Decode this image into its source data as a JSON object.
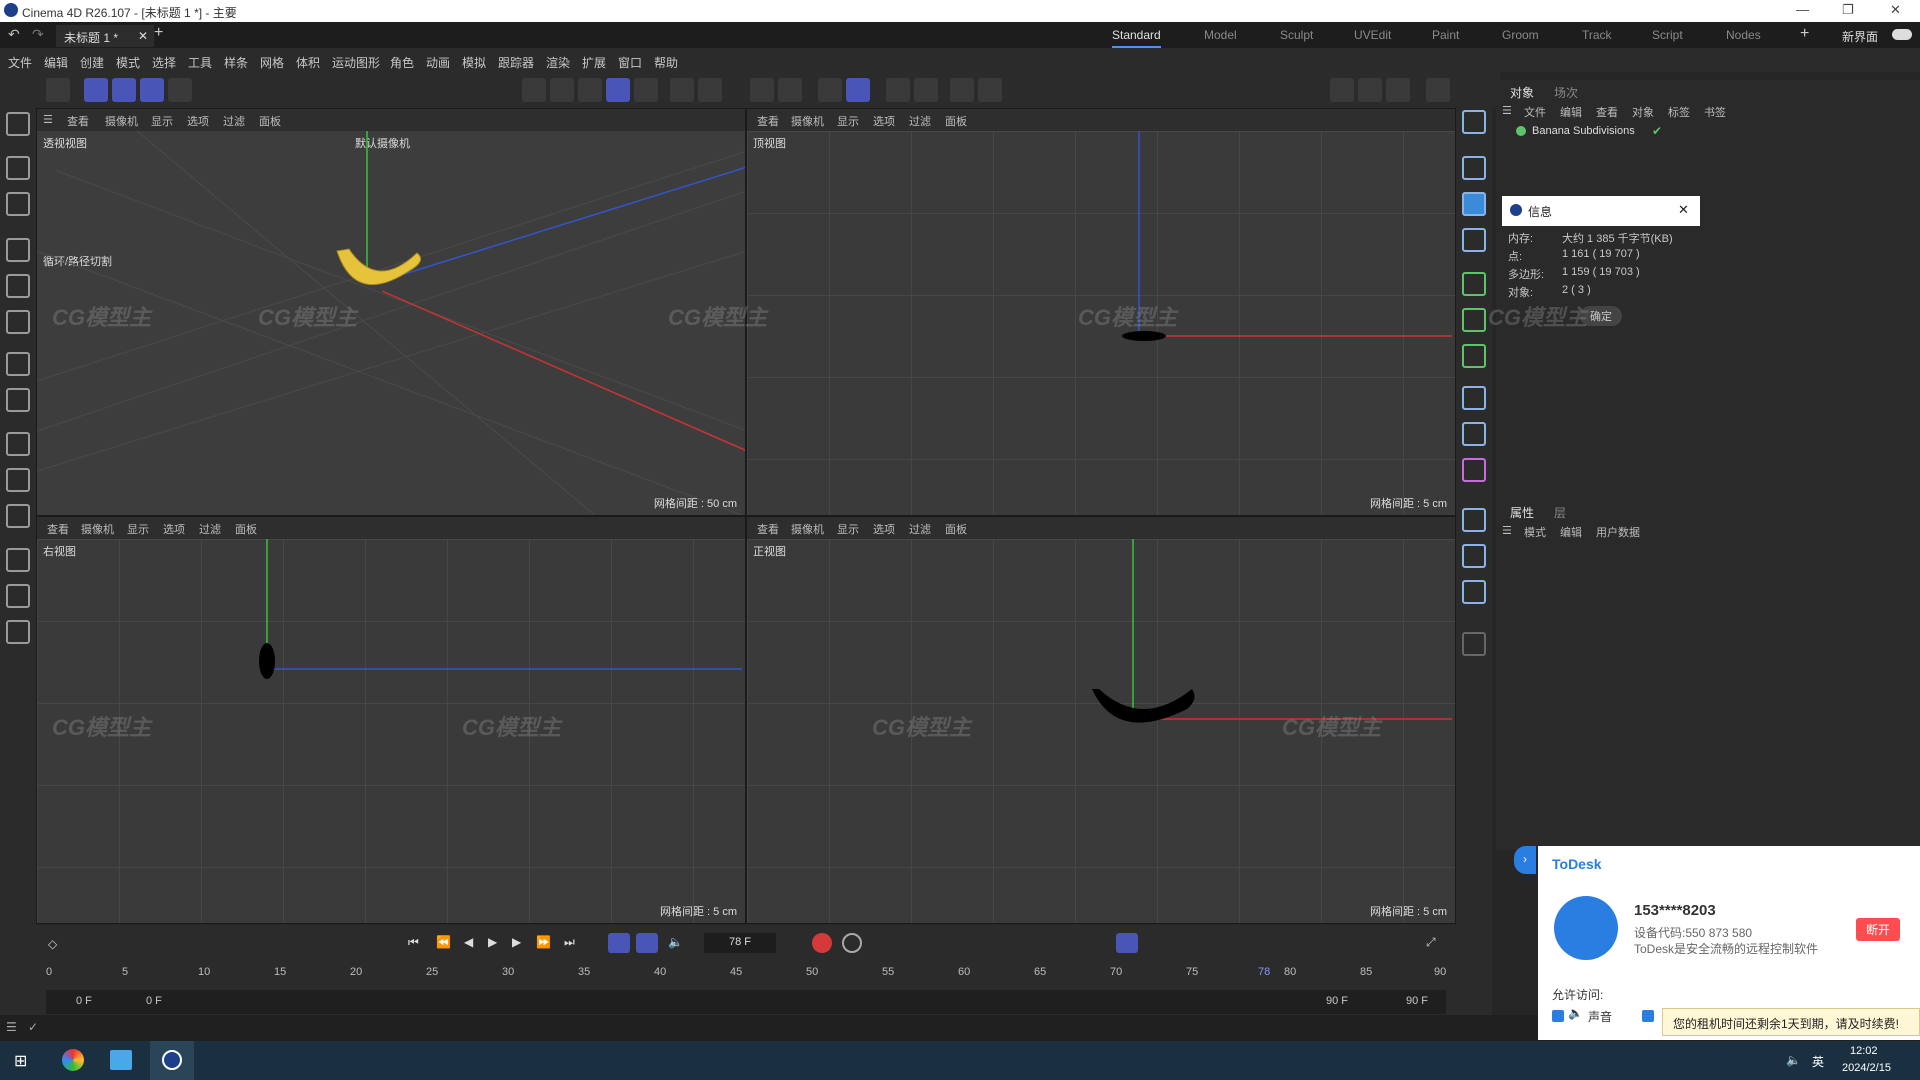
{
  "title": "Cinema 4D R26.107 - [未标题 1 *] - 主要",
  "doc_tab": "未标题 1 *",
  "layouts": [
    "Standard",
    "Model",
    "Sculpt",
    "UVEdit",
    "Paint",
    "Groom",
    "Track",
    "Script",
    "Nodes"
  ],
  "new_interface": "新界面",
  "menus": [
    "文件",
    "编辑",
    "创建",
    "模式",
    "选择",
    "工具",
    "样条",
    "网格",
    "体积",
    "运动图形",
    "角色",
    "动画",
    "模拟",
    "跟踪器",
    "渲染",
    "扩展",
    "窗口",
    "帮助"
  ],
  "viewport_menu": [
    "查看",
    "摄像机",
    "显示",
    "选项",
    "过滤",
    "面板"
  ],
  "viewports": [
    {
      "label": "透视视图",
      "camera": "默认摄像机",
      "loop_cut": "循环/路径切割",
      "grid": "网格间距 : 50 cm"
    },
    {
      "label": "顶视图",
      "grid": "网格间距 : 5 cm"
    },
    {
      "label": "右视图",
      "grid": "网格间距 : 5 cm"
    },
    {
      "label": "正视图",
      "grid": "网格间距 : 5 cm"
    }
  ],
  "object_panel": {
    "tabs": [
      "对象",
      "场次"
    ],
    "menu": [
      "文件",
      "编辑",
      "查看",
      "对象",
      "标签",
      "书签"
    ],
    "item": "Banana Subdivisions"
  },
  "info": {
    "title": "信息",
    "rows": [
      [
        "内存:",
        "大约 1 385 千字节(KB)"
      ],
      [
        "点:",
        "1 161 ( 19 707 )"
      ],
      [
        "多边形:",
        "1 159 ( 19 703 )"
      ],
      [
        "对象:",
        "2 ( 3 )"
      ]
    ],
    "ok": "确定"
  },
  "attr_panel": {
    "tabs": [
      "属性",
      "层"
    ],
    "menu": [
      "模式",
      "编辑",
      "用户数据"
    ]
  },
  "timeline": {
    "frame": "78 F",
    "ruler": [
      "0",
      "5",
      "10",
      "15",
      "20",
      "25",
      "30",
      "35",
      "40",
      "45",
      "50",
      "55",
      "60",
      "65",
      "70",
      "75",
      "78",
      "80",
      "85",
      "90"
    ],
    "start": "0 F",
    "start2": "0 F",
    "end": "90 F",
    "end2": "90 F"
  },
  "todesk": {
    "brand": "ToDesk",
    "user": "153****8203",
    "device": "设备代码:550 873 580",
    "desc": "ToDesk是安全流畅的远程控制软件",
    "disconnect": "断开",
    "allow": "允许访问:",
    "sound": "声音",
    "notice": "您的租机时间还剩余1天到期，请及时续费!"
  },
  "clock": {
    "time": "12:02",
    "date": "2024/2/15",
    "ime": "英"
  },
  "watermark": "CG模型主"
}
